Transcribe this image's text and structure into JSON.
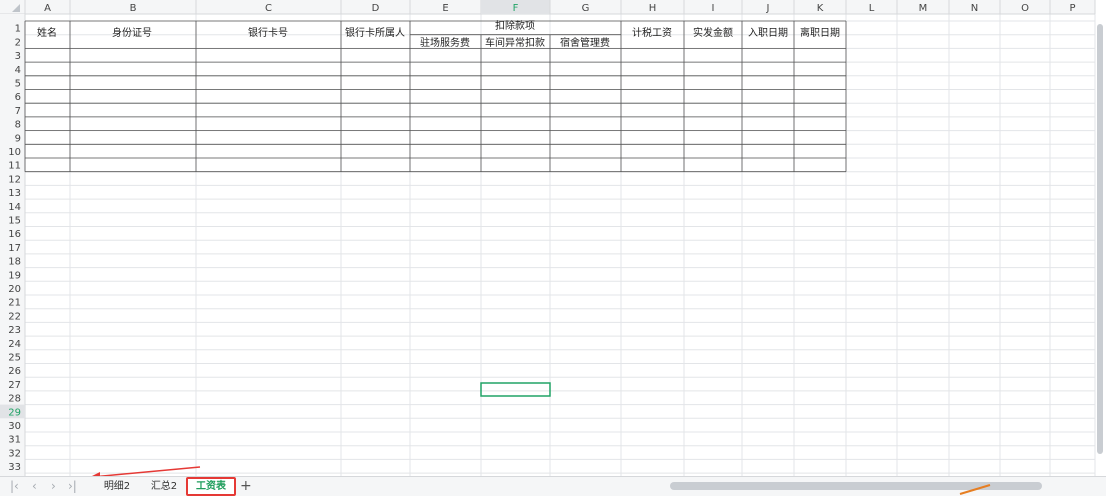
{
  "sheet": {
    "columns": [
      "A",
      "B",
      "C",
      "D",
      "E",
      "F",
      "G",
      "H",
      "I",
      "J",
      "K",
      "L",
      "M",
      "N",
      "O",
      "P"
    ],
    "row_count": 36,
    "selected_column": "F",
    "selected_row": 29,
    "header": {
      "name": "姓名",
      "id_number": "身份证号",
      "bank_card": "银行卡号",
      "bank_owner": "银行卡所属人",
      "deductions_group": "扣除款项",
      "deduction_items": [
        "驻场服务费",
        "车间异常扣款",
        "宿舍管理费"
      ],
      "taxable_wage": "计税工资",
      "net_pay": "实发金额",
      "hire_date": "入职日期",
      "leave_date": "离职日期"
    }
  },
  "tabs": {
    "items": [
      "明细2",
      "汇总2",
      "工资表"
    ],
    "active_index": 2,
    "add_label": "+",
    "nav_icons": [
      "first-sheet-icon",
      "prev-sheet-icon",
      "next-sheet-icon",
      "last-sheet-icon"
    ]
  },
  "colors": {
    "selection": "#21a366",
    "active_tab_border": "#e53935",
    "arrow": "#e53935"
  }
}
